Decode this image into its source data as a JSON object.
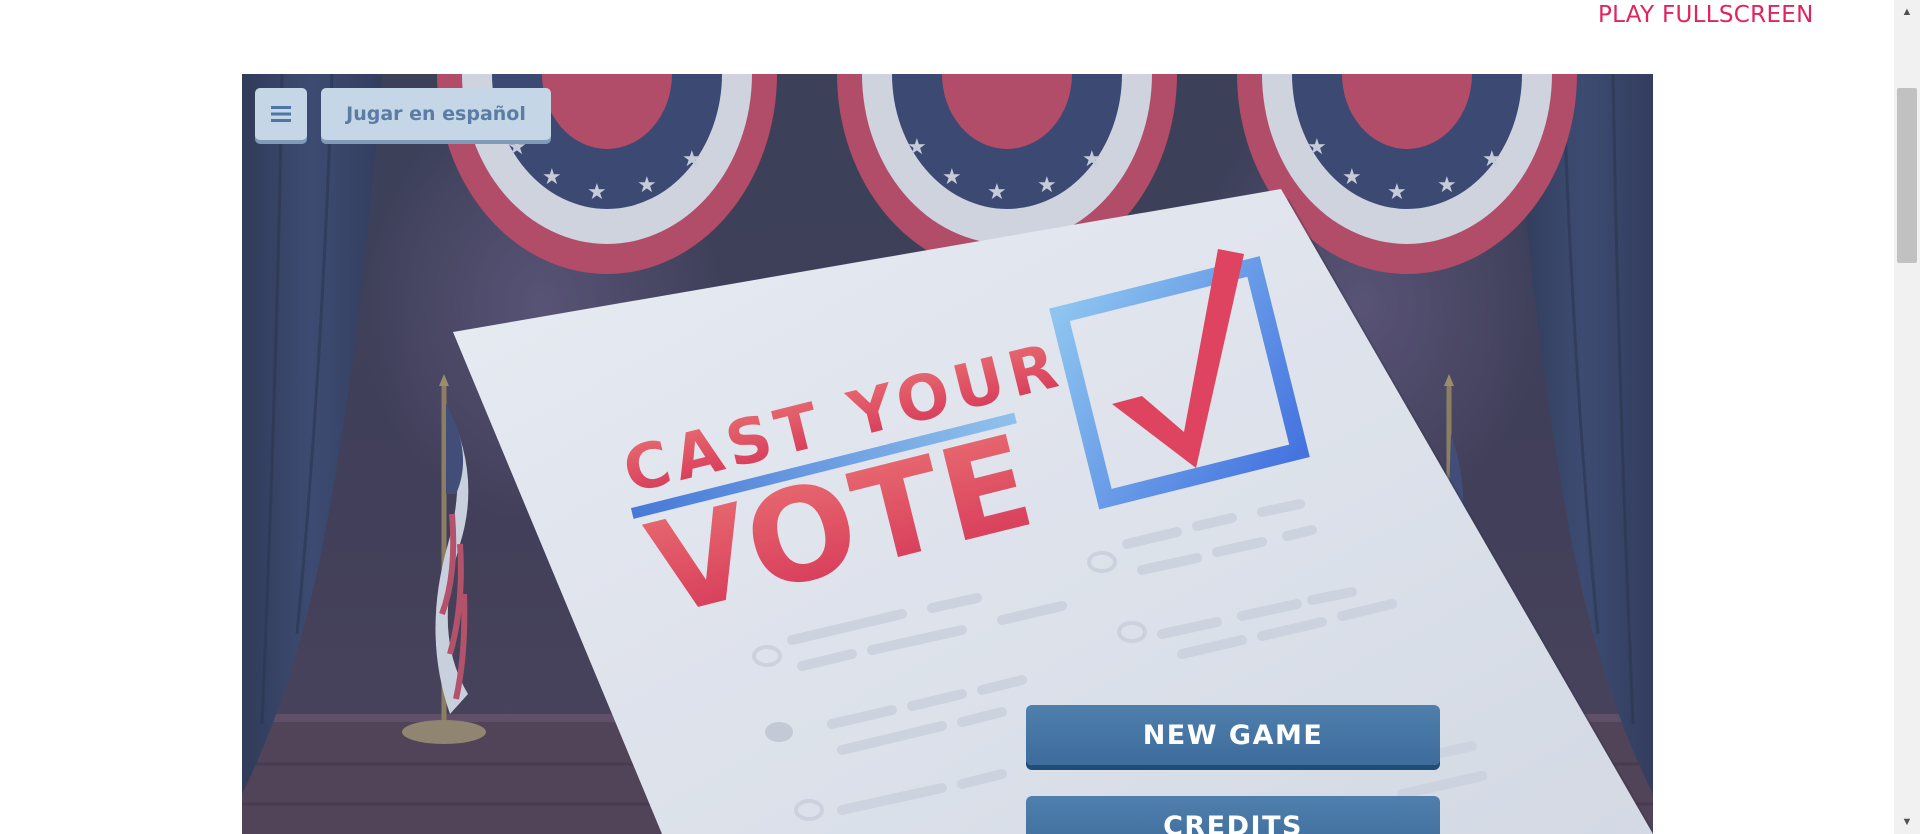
{
  "header": {
    "fullscreen_label": "PLAY FULLSCREEN"
  },
  "toolbar": {
    "language_button": "Jugar en español"
  },
  "title": {
    "line1": "CAST YOUR",
    "line2": "VOTE"
  },
  "menu": {
    "new_game": "NEW GAME",
    "credits": "CREDITS"
  },
  "colors": {
    "link": "#e0245e",
    "button_blue": "#3d6c9c",
    "title_red": "#e4405a",
    "checkbox_blue": "#4f86e0"
  },
  "icons": {
    "menu": "hamburger-icon",
    "scroll_up": "arrow-up-icon",
    "scroll_down": "arrow-down-icon"
  }
}
